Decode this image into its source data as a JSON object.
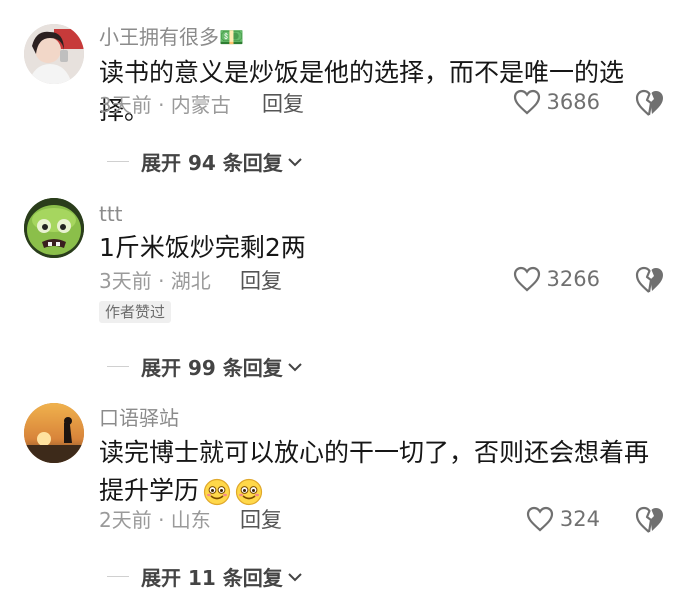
{
  "comments": [
    {
      "username": "小王拥有很多💵",
      "text": "读书的意义是炒饭是他的选择，而不是唯一的选择。",
      "time_location": "3天前 · 内蒙古",
      "reply_label": "回复",
      "likes": "3686",
      "expand_label": "展开 94 条回复"
    },
    {
      "username": "ttt",
      "text": "1斤米饭炒完剩2两",
      "time_location": "3天前 · 湖北",
      "reply_label": "回复",
      "likes": "3266",
      "badge": "作者赞过",
      "expand_label": "展开 99 条回复"
    },
    {
      "username": "口语驿站",
      "text": "读完博士就可以放心的干一切了，否则还会想着再提升学历",
      "time_location": "2天前 · 山东",
      "reply_label": "回复",
      "likes": "324",
      "expand_label": "展开 11 条回复"
    }
  ],
  "icons": {
    "like": "heart-outline-icon",
    "dislike": "broken-heart-icon",
    "expand": "chevron-down-icon"
  },
  "colors": {
    "text": "#161616",
    "meta": "#9a9a9a"
  }
}
